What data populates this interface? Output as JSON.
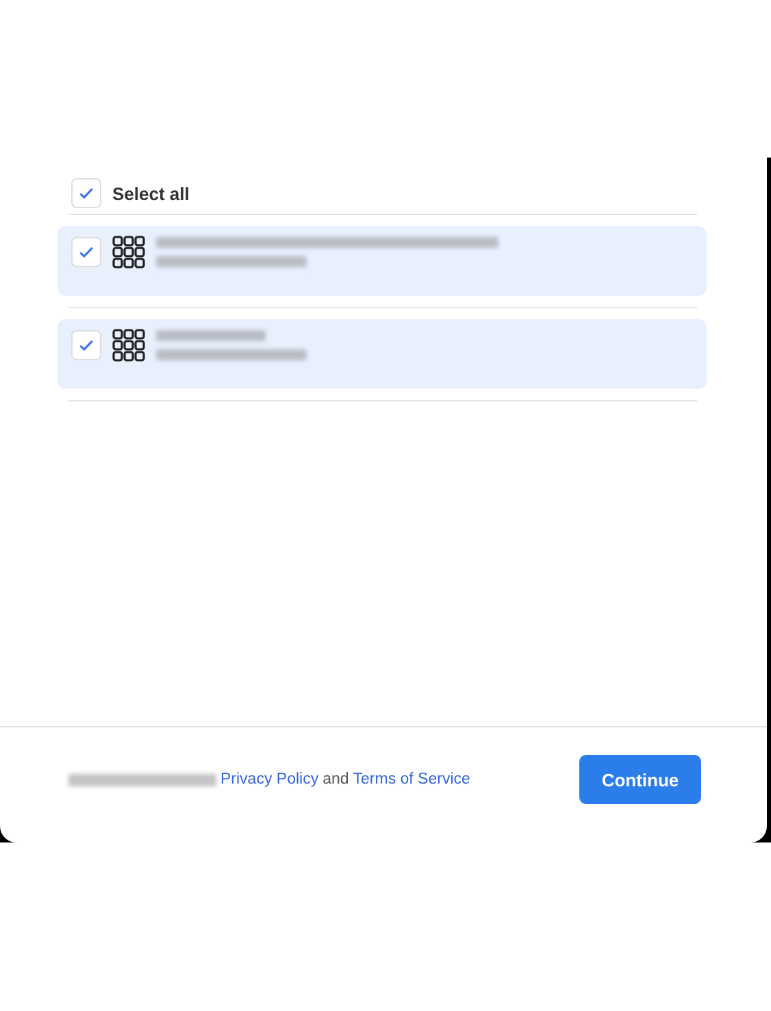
{
  "select_all": {
    "label": "Select all",
    "checked": true
  },
  "items": [
    {
      "checked": true
    },
    {
      "checked": true
    }
  ],
  "footer": {
    "privacy_link": "Privacy Policy",
    "conjunction": "and",
    "terms_link": "Terms of Service"
  },
  "button": "Continue"
}
